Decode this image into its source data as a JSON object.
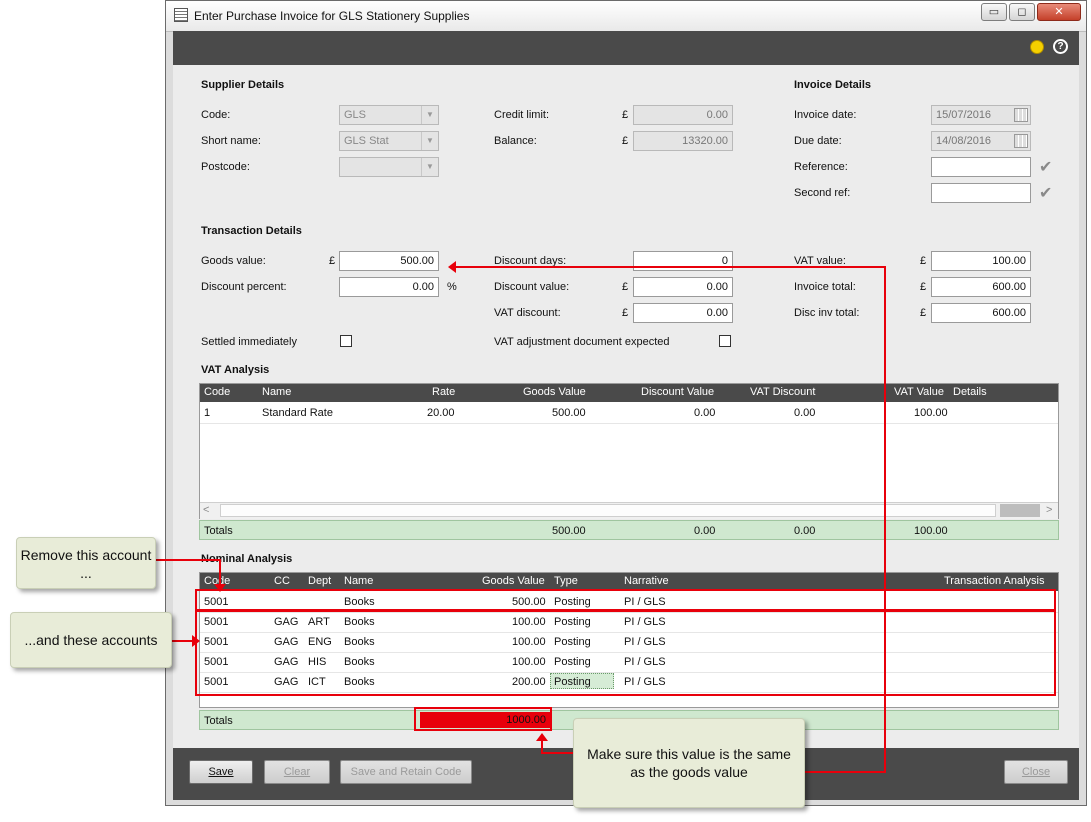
{
  "window": {
    "title": "Enter Purchase Invoice for GLS Stationery Supplies",
    "min_btn": "▭",
    "max_btn": "◻",
    "close_btn": "✕"
  },
  "supplier": {
    "heading": "Supplier Details",
    "code_label": "Code:",
    "code_value": "GLS",
    "short_name_label": "Short name:",
    "short_name_value": "GLS Stat",
    "postcode_label": "Postcode:",
    "postcode_value": "",
    "credit_limit_label": "Credit limit:",
    "credit_limit_value": "0.00",
    "balance_label": "Balance:",
    "balance_value": "13320.00",
    "currency": "£"
  },
  "invoice": {
    "heading": "Invoice Details",
    "invoice_date_label": "Invoice date:",
    "invoice_date_value": "15/07/2016",
    "due_date_label": "Due date:",
    "due_date_value": "14/08/2016",
    "reference_label": "Reference:",
    "reference_value": "",
    "second_ref_label": "Second ref:",
    "second_ref_value": ""
  },
  "transaction": {
    "heading": "Transaction Details",
    "goods_value_label": "Goods value:",
    "goods_value": "500.00",
    "discount_percent_label": "Discount percent:",
    "discount_percent": "0.00",
    "percent_sign": "%",
    "discount_days_label": "Discount days:",
    "discount_days": "0",
    "discount_value_label": "Discount value:",
    "discount_value": "0.00",
    "vat_discount_label": "VAT discount:",
    "vat_discount": "0.00",
    "vat_value_label": "VAT value:",
    "vat_value": "100.00",
    "invoice_total_label": "Invoice total:",
    "invoice_total": "600.00",
    "disc_inv_total_label": "Disc inv total:",
    "disc_inv_total": "600.00",
    "settled_label": "Settled immediately",
    "vat_adj_label": "VAT adjustment document expected",
    "currency": "£"
  },
  "vat_analysis": {
    "heading": "VAT Analysis",
    "columns": [
      "Code",
      "Name",
      "Rate",
      "Goods Value",
      "Discount Value",
      "VAT Discount",
      "VAT Value",
      "Details"
    ],
    "rows": [
      {
        "code": "1",
        "name": "Standard Rate",
        "rate": "20.00",
        "goods": "500.00",
        "discount": "0.00",
        "vat_discount": "0.00",
        "vat_value": "100.00",
        "details": ""
      }
    ],
    "totals_label": "Totals",
    "totals": {
      "goods": "500.00",
      "discount": "0.00",
      "vat_discount": "0.00",
      "vat_value": "100.00"
    }
  },
  "nominal_analysis": {
    "heading": "Nominal Analysis",
    "columns": [
      "Code",
      "CC",
      "Dept",
      "Name",
      "Goods Value",
      "Type",
      "Narrative",
      "Transaction Analysis"
    ],
    "rows": [
      {
        "code": "5001",
        "cc": "",
        "dept": "",
        "name": "Books",
        "goods": "500.00",
        "type": "Posting",
        "narrative": "PI / GLS"
      },
      {
        "code": "5001",
        "cc": "GAG",
        "dept": "ART",
        "name": "Books",
        "goods": "100.00",
        "type": "Posting",
        "narrative": "PI / GLS"
      },
      {
        "code": "5001",
        "cc": "GAG",
        "dept": "ENG",
        "name": "Books",
        "goods": "100.00",
        "type": "Posting",
        "narrative": "PI / GLS"
      },
      {
        "code": "5001",
        "cc": "GAG",
        "dept": "HIS",
        "name": "Books",
        "goods": "100.00",
        "type": "Posting",
        "narrative": "PI / GLS"
      },
      {
        "code": "5001",
        "cc": "GAG",
        "dept": "ICT",
        "name": "Books",
        "goods": "200.00",
        "type": "Posting",
        "narrative": "PI / GLS"
      }
    ],
    "totals_label": "Totals",
    "totals_goods": "1000.00"
  },
  "buttons": {
    "save": "Save",
    "clear": "Clear",
    "save_retain": "Save and Retain Code",
    "close": "Close"
  },
  "callouts": {
    "remove": "Remove this account ...",
    "these": "...and these accounts",
    "make_sure": "Make sure this value is the same as the goods value"
  },
  "colors": {
    "annotation_red": "#e8000b",
    "totals_green": "#cfe8cf",
    "header_dark": "#4a4a4a"
  }
}
